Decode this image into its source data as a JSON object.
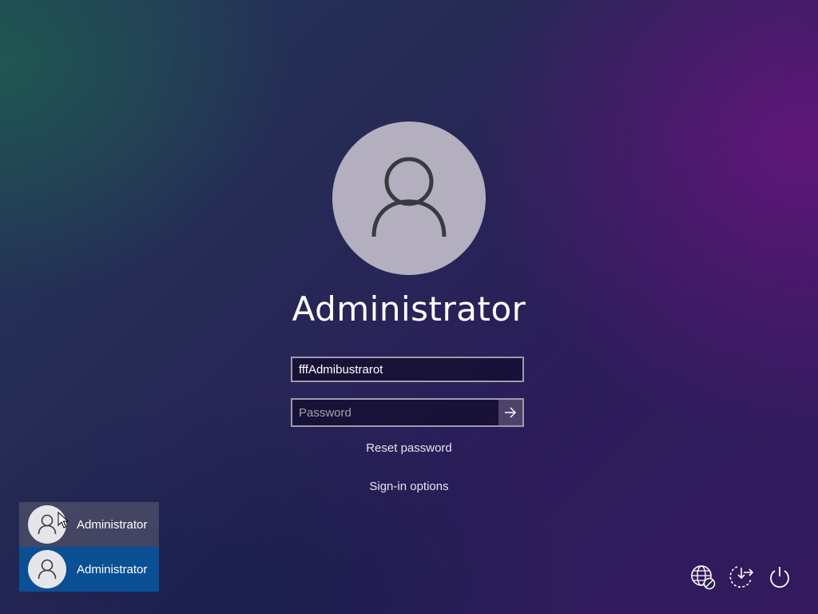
{
  "user": {
    "name": "Administrator"
  },
  "login": {
    "username_value": "fffAdmibustrarot",
    "password_placeholder": "Password",
    "reset_link": "Reset password",
    "signin_options_link": "Sign-in options"
  },
  "user_list": [
    {
      "name": "Administrator",
      "state": "hover"
    },
    {
      "name": "Administrator",
      "state": "selected"
    }
  ],
  "tray": {
    "icons": [
      "network-icon",
      "ease-of-access-icon",
      "power-icon"
    ]
  },
  "colors": {
    "avatar_bg": "#b3afbf",
    "selected_user": "#0b4f95",
    "bg_teal": "#1f5c50",
    "bg_purple": "#68167e"
  }
}
